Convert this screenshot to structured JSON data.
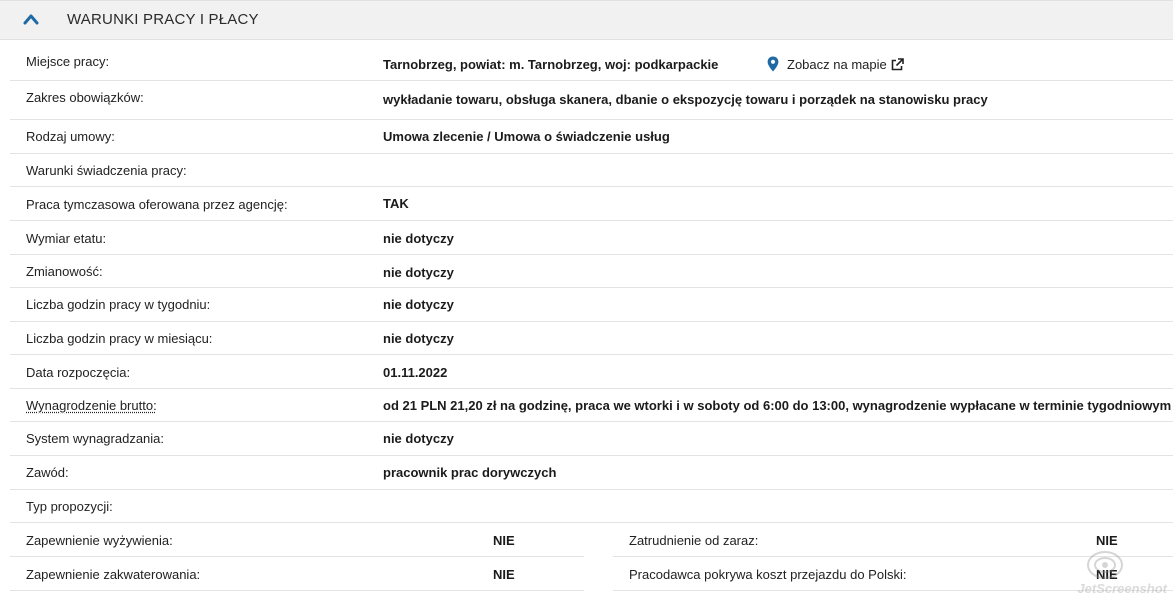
{
  "section": {
    "title": "WARUNKI PRACY I PŁACY"
  },
  "rows": {
    "location": {
      "label": "Miejsce pracy:",
      "value": "Tarnobrzeg, powiat: m. Tarnobrzeg, woj: podkarpackie",
      "map_link": "Zobacz na mapie"
    },
    "duties": {
      "label": "Zakres obowiązków:",
      "value": "wykładanie towaru, obsługa skanera, dbanie o ekspozycję towaru i porządek na stanowisku pracy"
    },
    "contract": {
      "label": "Rodzaj umowy:",
      "value": "Umowa zlecenie / Umowa o świadczenie usług"
    },
    "conditions": {
      "label": "Warunki świadczenia pracy:",
      "value": ""
    },
    "temp_agency": {
      "label": "Praca tymczasowa oferowana przez agencję:",
      "value": "TAK"
    },
    "fulltime": {
      "label": "Wymiar etatu:",
      "value": "nie dotyczy"
    },
    "shifts": {
      "label": "Zmianowość:",
      "value": "nie dotyczy"
    },
    "hours_week": {
      "label": "Liczba godzin pracy w tygodniu:",
      "value": "nie dotyczy"
    },
    "hours_month": {
      "label": "Liczba godzin pracy w miesiącu:",
      "value": "nie dotyczy"
    },
    "start_date": {
      "label": "Data rozpoczęcia:",
      "value": "01.11.2022"
    },
    "salary": {
      "label": "Wynagrodzenie brutto:",
      "value": "od 21 PLN 21,20 zł na godzinę, praca we wtorki i w soboty od 6:00 do 13:00, wynagrodzenie wypłacane w terminie tygodniowym"
    },
    "pay_system": {
      "label": "System wynagradzania:",
      "value": "nie dotyczy"
    },
    "occupation": {
      "label": "Zawód:",
      "value": "pracownik prac dorywczych"
    },
    "proposal_type": {
      "label": "Typ propozycji:",
      "value": ""
    }
  },
  "pairs": {
    "food": {
      "label": "Zapewnienie wyżywienia:",
      "value": "NIE"
    },
    "immediate": {
      "label": "Zatrudnienie od zaraz:",
      "value": "NIE"
    },
    "housing": {
      "label": "Zapewnienie zakwaterowania:",
      "value": "NIE"
    },
    "travel": {
      "label": "Pracodawca pokrywa koszt przejazdu do Polski:",
      "value": "NIE"
    }
  },
  "watermark": {
    "text": "JetScreenshot"
  },
  "colors": {
    "accent": "#1f6aa5",
    "header_bg": "#f1f1f1",
    "divider": "#e3e3e3"
  }
}
